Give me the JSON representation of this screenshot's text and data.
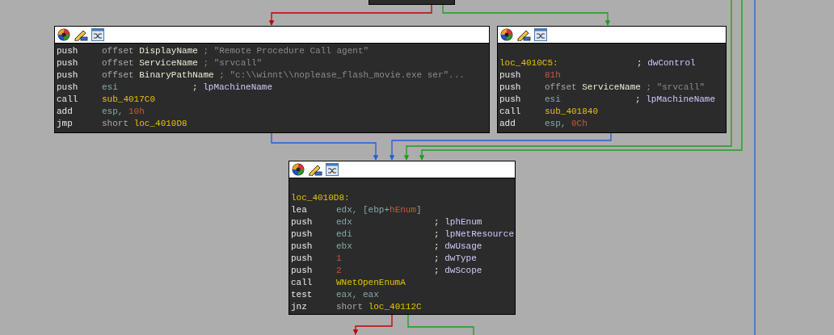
{
  "blocks": [
    {
      "lines": [
        {
          "kind": "instr",
          "mnemonic": "push",
          "operands": [
            [
              {
                "text": "offset",
                "kind": "kw"
              }
            ],
            [
              {
                "text": "DisplayName",
                "kind": "name"
              }
            ]
          ],
          "comment": [
            {
              "text": ";",
              "kind": "cstr"
            },
            {
              "text": "\"Remote Procedure Call agent\"",
              "kind": "cstr"
            }
          ]
        },
        {
          "kind": "instr",
          "mnemonic": "push",
          "operands": [
            [
              {
                "text": "offset",
                "kind": "kw"
              }
            ],
            [
              {
                "text": "ServiceName",
                "kind": "name"
              }
            ]
          ],
          "comment": [
            {
              "text": ";",
              "kind": "cstr"
            },
            {
              "text": "\"srvcall\"",
              "kind": "cstr"
            }
          ]
        },
        {
          "kind": "instr",
          "mnemonic": "push",
          "operands": [
            [
              {
                "text": "offset",
                "kind": "kw"
              }
            ],
            [
              {
                "text": "BinaryPathName",
                "kind": "name"
              }
            ]
          ],
          "comment": [
            {
              "text": ";",
              "kind": "cstr"
            },
            {
              "text": "\"c:\\\\winnt\\\\noplease_flash_movie.exe ser\"...",
              "kind": "cstr"
            }
          ]
        },
        {
          "kind": "instr",
          "mnemonic": "push",
          "operands": [
            [
              {
                "text": "esi",
                "kind": "reg"
              }
            ]
          ],
          "comment": [
            {
              "text": ";",
              "kind": "punct"
            },
            {
              "text": "lpMachineName",
              "kind": "cname"
            }
          ]
        },
        {
          "kind": "instr",
          "mnemonic": "call",
          "operands": [
            [
              {
                "text": "sub_4017C0",
                "kind": "func"
              }
            ]
          ]
        },
        {
          "kind": "instr",
          "mnemonic": "add",
          "operands": [
            [
              {
                "text": "esp,",
                "kind": "reg"
              }
            ],
            [
              {
                "text": "10h",
                "kind": "num"
              }
            ]
          ]
        },
        {
          "kind": "instr",
          "mnemonic": "jmp",
          "operands": [
            [
              {
                "text": "short",
                "kind": "kw"
              }
            ],
            [
              {
                "text": "loc_4010D8",
                "kind": "func"
              }
            ]
          ]
        }
      ]
    },
    {
      "lines": [
        {
          "kind": "blank"
        },
        {
          "kind": "label",
          "label": "loc_4010C5:",
          "comment": [
            {
              "text": ";",
              "kind": "punct"
            },
            {
              "text": "dwControl",
              "kind": "cname"
            }
          ]
        },
        {
          "kind": "instr",
          "mnemonic": "push",
          "operands": [
            [
              {
                "text": "81h",
                "kind": "num"
              }
            ]
          ]
        },
        {
          "kind": "instr",
          "mnemonic": "push",
          "operands": [
            [
              {
                "text": "offset",
                "kind": "kw"
              }
            ],
            [
              {
                "text": "ServiceName",
                "kind": "name"
              }
            ]
          ],
          "comment": [
            {
              "text": ";",
              "kind": "cstr"
            },
            {
              "text": "\"srvcall\"",
              "kind": "cstr"
            }
          ]
        },
        {
          "kind": "instr",
          "mnemonic": "push",
          "operands": [
            [
              {
                "text": "esi",
                "kind": "reg"
              }
            ]
          ],
          "comment": [
            {
              "text": ";",
              "kind": "punct"
            },
            {
              "text": "lpMachineName",
              "kind": "cname"
            }
          ]
        },
        {
          "kind": "instr",
          "mnemonic": "call",
          "operands": [
            [
              {
                "text": "sub_401840",
                "kind": "func"
              }
            ]
          ]
        },
        {
          "kind": "instr",
          "mnemonic": "add",
          "operands": [
            [
              {
                "text": "esp,",
                "kind": "reg"
              }
            ],
            [
              {
                "text": "0Ch",
                "kind": "num"
              }
            ]
          ]
        }
      ]
    },
    {
      "lines": [
        {
          "kind": "blank"
        },
        {
          "kind": "label",
          "label": "loc_4010D8:"
        },
        {
          "kind": "instr",
          "mnemonic": "lea",
          "operands": [
            [
              {
                "text": "edx,",
                "kind": "reg"
              }
            ],
            [
              {
                "text": "[ebp+",
                "kind": "reg"
              },
              {
                "text": "hEnum",
                "kind": "num"
              },
              {
                "text": "]",
                "kind": "reg"
              }
            ]
          ]
        },
        {
          "kind": "instr",
          "mnemonic": "push",
          "operands": [
            [
              {
                "text": "edx",
                "kind": "reg"
              }
            ]
          ],
          "comment": [
            {
              "text": ";",
              "kind": "punct"
            },
            {
              "text": "lphEnum",
              "kind": "cname"
            }
          ]
        },
        {
          "kind": "instr",
          "mnemonic": "push",
          "operands": [
            [
              {
                "text": "edi",
                "kind": "reg"
              }
            ]
          ],
          "comment": [
            {
              "text": ";",
              "kind": "punct"
            },
            {
              "text": "lpNetResource",
              "kind": "cname"
            }
          ]
        },
        {
          "kind": "instr",
          "mnemonic": "push",
          "operands": [
            [
              {
                "text": "ebx",
                "kind": "reg"
              }
            ]
          ],
          "comment": [
            {
              "text": ";",
              "kind": "punct"
            },
            {
              "text": "dwUsage",
              "kind": "cname"
            }
          ]
        },
        {
          "kind": "instr",
          "mnemonic": "push",
          "operands": [
            [
              {
                "text": "1",
                "kind": "num"
              }
            ]
          ],
          "comment": [
            {
              "text": ";",
              "kind": "punct"
            },
            {
              "text": "dwType",
              "kind": "cname"
            }
          ]
        },
        {
          "kind": "instr",
          "mnemonic": "push",
          "operands": [
            [
              {
                "text": "2",
                "kind": "num"
              }
            ]
          ],
          "comment": [
            {
              "text": ";",
              "kind": "punct"
            },
            {
              "text": "dwScope",
              "kind": "cname"
            }
          ]
        },
        {
          "kind": "instr",
          "mnemonic": "call",
          "operands": [
            [
              {
                "text": "WNetOpenEnumA",
                "kind": "func"
              }
            ]
          ]
        },
        {
          "kind": "instr",
          "mnemonic": "test",
          "operands": [
            [
              {
                "text": "eax,",
                "kind": "reg"
              }
            ],
            [
              {
                "text": "eax",
                "kind": "reg"
              }
            ]
          ]
        },
        {
          "kind": "instr",
          "mnemonic": "jnz",
          "operands": [
            [
              {
                "text": "short",
                "kind": "kw"
              }
            ],
            [
              {
                "text": "loc_40112C",
                "kind": "func"
              }
            ]
          ]
        }
      ]
    }
  ]
}
